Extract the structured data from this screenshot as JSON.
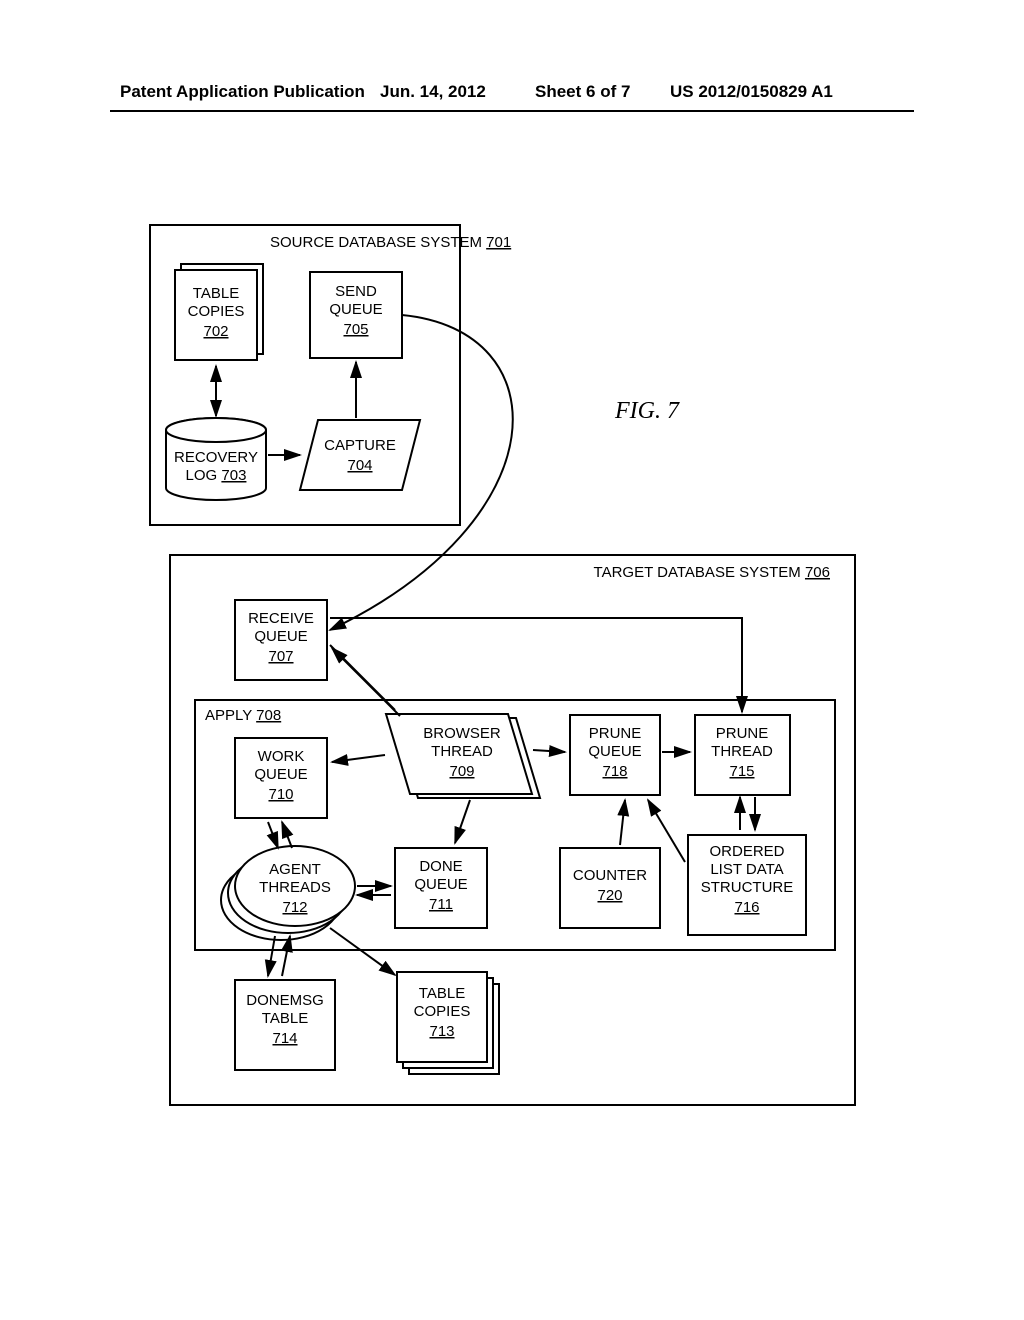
{
  "header": {
    "left": "Patent Application Publication",
    "center": "Jun. 14, 2012",
    "sheet": "Sheet 6 of 7",
    "right": "US 2012/0150829 A1"
  },
  "figure": {
    "caption": "FIG. 7"
  },
  "source": {
    "title": "SOURCE DATABASE SYSTEM",
    "title_ref": "701",
    "table_copies": {
      "l1": "TABLE",
      "l2": "COPIES",
      "ref": "702"
    },
    "send_queue": {
      "l1": "SEND",
      "l2": "QUEUE",
      "ref": "705"
    },
    "recovery_log": {
      "l1": "RECOVERY",
      "l2": "LOG",
      "ref": "703"
    },
    "capture": {
      "l1": "CAPTURE",
      "ref": "704"
    }
  },
  "target": {
    "title": "TARGET DATABASE SYSTEM",
    "title_ref": "706",
    "receive_queue": {
      "l1": "RECEIVE",
      "l2": "QUEUE",
      "ref": "707"
    },
    "apply": {
      "l1": "APPLY",
      "ref": "708"
    },
    "work_queue": {
      "l1": "WORK",
      "l2": "QUEUE",
      "ref": "710"
    },
    "browser_thread": {
      "l1": "BROWSER",
      "l2": "THREAD",
      "ref": "709"
    },
    "prune_queue": {
      "l1": "PRUNE",
      "l2": "QUEUE",
      "ref": "718"
    },
    "prune_thread": {
      "l1": "PRUNE",
      "l2": "THREAD",
      "ref": "715"
    },
    "agent_threads": {
      "l1": "AGENT",
      "l2": "THREADS",
      "ref": "712"
    },
    "done_queue": {
      "l1": "DONE",
      "l2": "QUEUE",
      "ref": "711"
    },
    "counter": {
      "l1": "COUNTER",
      "ref": "720"
    },
    "ordered_list": {
      "l1": "ORDERED",
      "l2": "LIST DATA",
      "l3": "STRUCTURE",
      "ref": "716"
    },
    "donemsg_table": {
      "l1": "DONEMSG",
      "l2": "TABLE",
      "ref": "714"
    },
    "table_copies": {
      "l1": "TABLE",
      "l2": "COPIES",
      "ref": "713"
    }
  }
}
